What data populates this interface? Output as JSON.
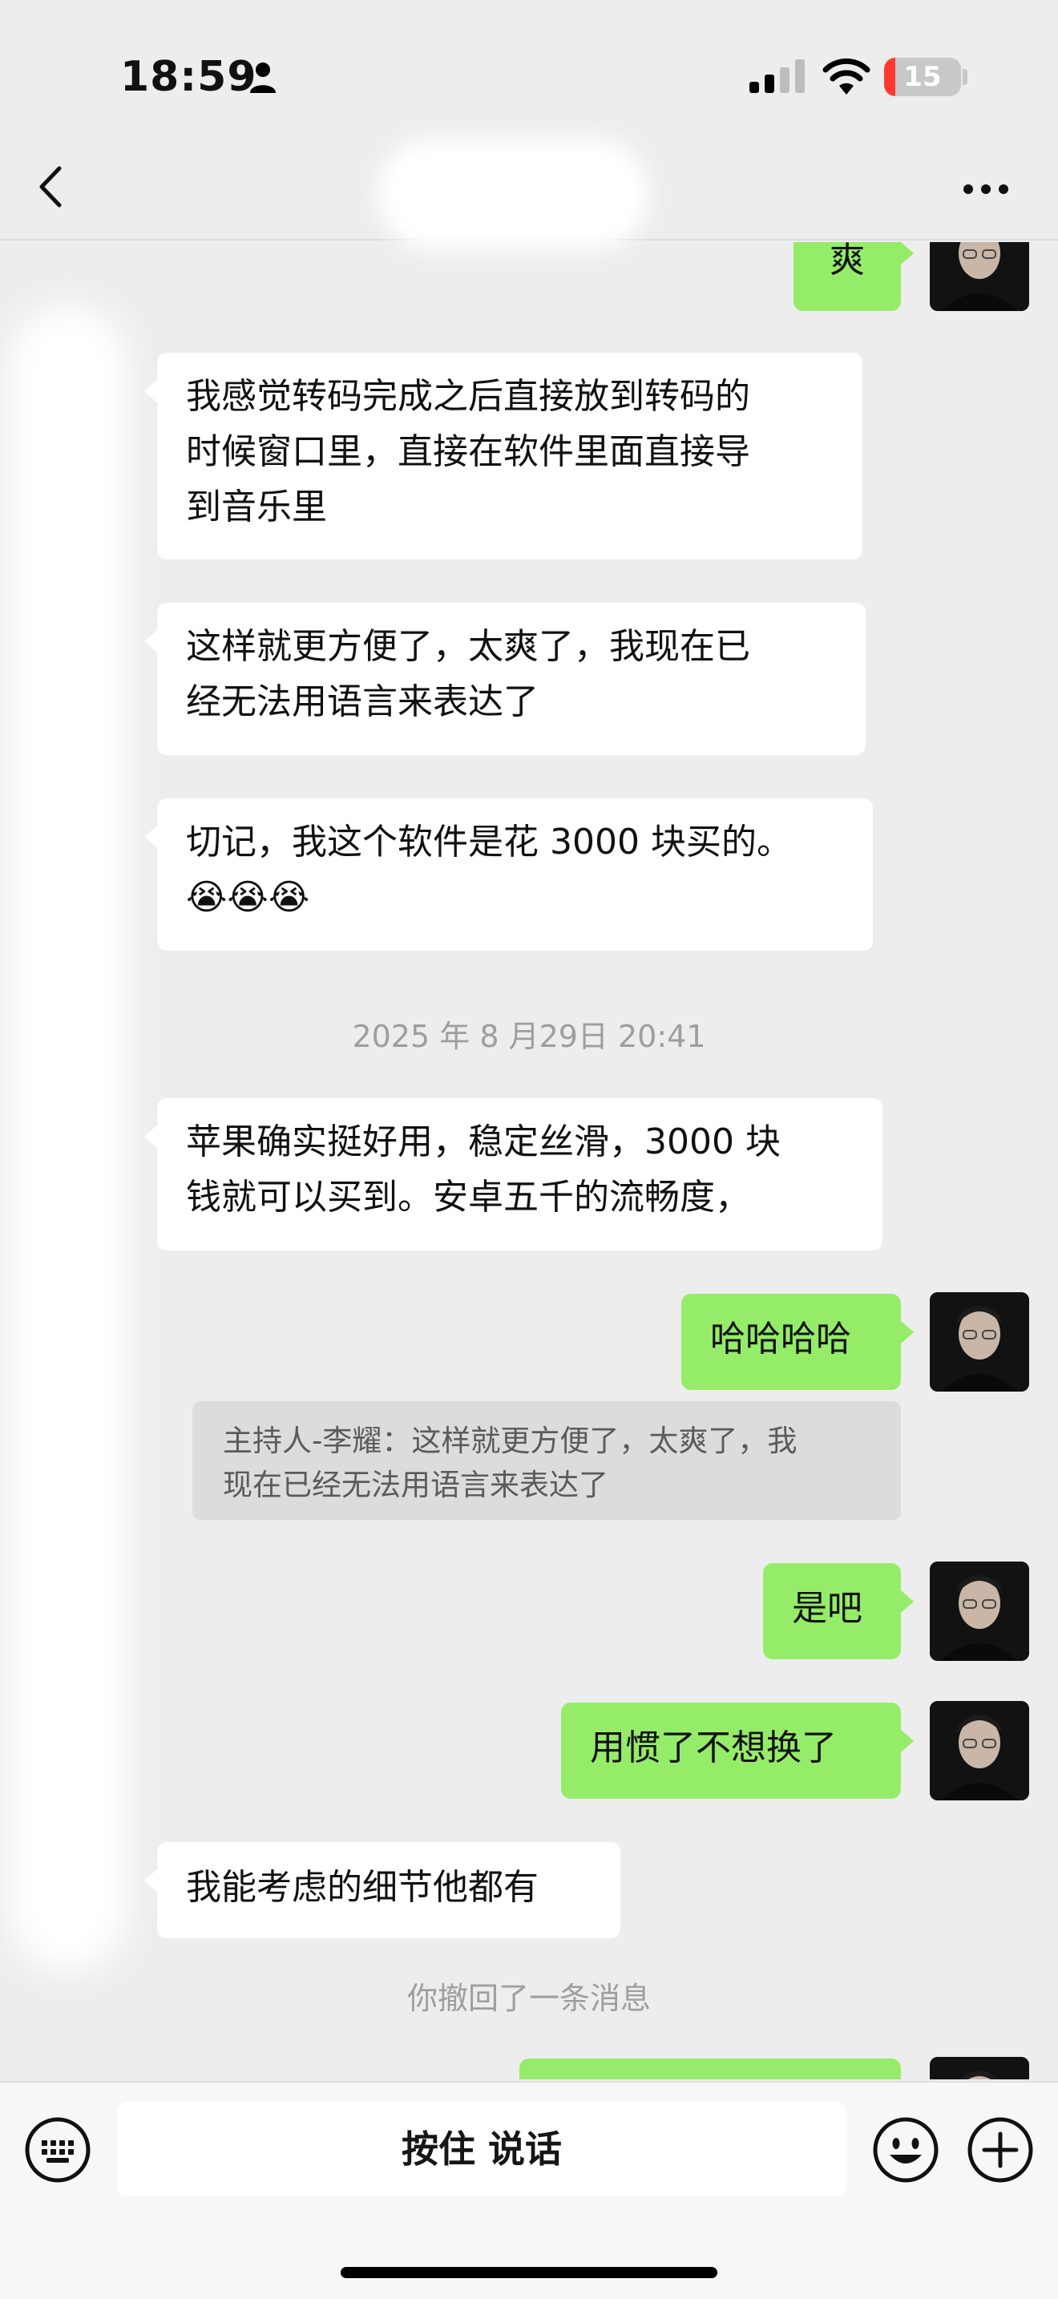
{
  "status_bar": {
    "time": "18:59",
    "battery_percent": "15",
    "battery_level": 0.15,
    "battery_color": "#ff3b30",
    "icons": [
      "person-icon",
      "cellular-signal-icon",
      "wifi-icon",
      "battery-icon"
    ]
  },
  "nav_bar": {
    "title": "",
    "icons": [
      "chevron-left-icon",
      "more-dots-icon"
    ]
  },
  "messages": [
    {
      "side": "right",
      "text": "爽",
      "partial": true
    },
    {
      "side": "left",
      "lines": [
        "我感觉转码完成之后直接放到转码的",
        "时候窗口里，直接在软件里面直接导",
        "到音乐里"
      ]
    },
    {
      "side": "left",
      "lines": [
        "这样就更方便了，太爽了，我现在已",
        "经无法用语言来表达了"
      ]
    },
    {
      "side": "left",
      "lines": [
        "切记，我这个软件是花 3000 块买的。",
        "😭😭😭"
      ]
    },
    {
      "type": "timestamp",
      "text": "2025 年 8 月29日 20:41"
    },
    {
      "side": "left",
      "lines": [
        "苹果确实挺好用，稳定丝滑，3000 块",
        "钱就可以买到。安卓五千的流畅度，"
      ]
    },
    {
      "side": "right",
      "text": "哈哈哈哈",
      "quote_lines": [
        "主持人-李耀：这样就更方便了，太爽了，我",
        "现在已经无法用语言来表达了"
      ]
    },
    {
      "side": "right",
      "text": "是吧"
    },
    {
      "side": "right",
      "text": "用惯了不想换了"
    },
    {
      "side": "left",
      "text": "我能考虑的细节他都有"
    },
    {
      "type": "system",
      "text": "你撤回了一条消息"
    }
  ],
  "input_bar": {
    "hold_to_talk_label": "按住 说话",
    "icons": [
      "keyboard-icon",
      "emoji-icon",
      "plus-icon"
    ]
  },
  "colors": {
    "background": "#ededed",
    "bubble_self": "#95ec69",
    "bubble_other": "#ffffff",
    "quote_background": "#dcdcdc",
    "system_text": "#9e9e9e"
  }
}
